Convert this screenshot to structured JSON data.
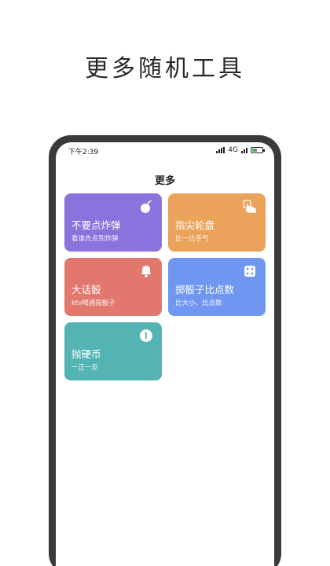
{
  "promo": {
    "title": "更多随机工具"
  },
  "status_bar": {
    "time": "下午2:39",
    "network": "4G"
  },
  "screen": {
    "title": "更多"
  },
  "cards": [
    {
      "title": "不要点炸弹",
      "subtitle": "看谁先点到炸弹",
      "icon": "bomb-icon",
      "color": "#8a73dc"
    },
    {
      "title": "指尖轮盘",
      "subtitle": "比一比手气",
      "icon": "finger-tap-icon",
      "color": "#eba35c"
    },
    {
      "title": "大话骰",
      "subtitle": "ktv喝酒摇骰子",
      "icon": "bell-icon",
      "color": "#e2776d"
    },
    {
      "title": "掷骰子比点数",
      "subtitle": "比大小、比点数",
      "icon": "dice-icon",
      "color": "#6f97f2"
    },
    {
      "title": "抛硬币",
      "subtitle": "一正一反",
      "icon": "coin-icon",
      "color": "#54b3b3"
    }
  ]
}
